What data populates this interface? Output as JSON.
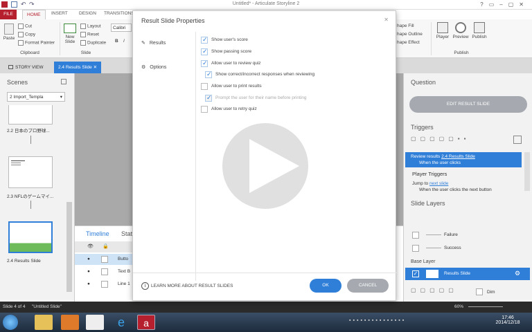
{
  "window": {
    "title": "Untitled* - Articulate Storyline 2"
  },
  "ribbon": {
    "tabs": [
      "FILE",
      "HOME",
      "INSERT",
      "DESIGN",
      "TRANSITIONS"
    ],
    "clipboard": {
      "paste": "Paste",
      "cut": "Cut",
      "copy": "Copy",
      "format_painter": "Format Painter",
      "group": "Clipboard"
    },
    "slide": {
      "new_slide": "New Slide",
      "layout": "Layout",
      "reset": "Reset",
      "duplicate": "Duplicate",
      "group": "Slide"
    },
    "font": {
      "name": "Calibri"
    },
    "shape": {
      "fill": "hape Fill",
      "outline": "hape Outline",
      "effect": "hape Effect"
    },
    "publish": {
      "player": "Player",
      "preview": "Preview",
      "publish": "Publish",
      "group": "Publish"
    }
  },
  "view_tabs": {
    "story": "STORY VIEW",
    "current": "2.4 Results Slide"
  },
  "scenes": {
    "title": "Scenes",
    "dropdown": "2 Import_Templa",
    "items": [
      {
        "label": "2.2 日本のプロ野球..."
      },
      {
        "label": "2.3 NFLのゲームマイ..."
      },
      {
        "label": "2.4 Results Slide"
      }
    ]
  },
  "timeline": {
    "title": "Timeline",
    "states": "Stat",
    "rows": [
      "Butto",
      "Text B",
      "Line 1"
    ]
  },
  "dialog": {
    "title": "Result Slide Properties",
    "nav": [
      {
        "label": "Results"
      },
      {
        "label": "Options"
      }
    ],
    "options": [
      {
        "label": "Show user's score",
        "checked": true,
        "disabled": false
      },
      {
        "label": "Show passing score",
        "checked": true,
        "disabled": false
      },
      {
        "label": "Allow user to review quiz",
        "checked": true,
        "disabled": false
      },
      {
        "label": "Show correct/incorrect responses when reviewing",
        "checked": true,
        "disabled": false
      },
      {
        "label": "Allow user to print results",
        "checked": false,
        "disabled": false
      },
      {
        "label": "Prompt the user for their name before printing",
        "checked": true,
        "disabled": true
      },
      {
        "label": "Allow user to retry quiz",
        "checked": false,
        "disabled": false
      }
    ],
    "learn_more": "LEARN MORE ABOUT RESULT SLIDES",
    "ok": "OK",
    "cancel": "CANCEL"
  },
  "right_panel": {
    "question_title": "Question",
    "edit_button": "EDIT RESULT SLIDE",
    "triggers_title": "Triggers",
    "trigger_selected": {
      "line1a": "Review results ",
      "line1b": "2.4 Results Slide",
      "line2": "When the user clicks"
    },
    "player_triggers": "Player Triggers",
    "player_trigger": {
      "line1a": "Jump to ",
      "line1b": "next slide",
      "line2": "When the user clicks the next button"
    },
    "layers_title": "Slide Layers",
    "layers": [
      "Failure",
      "Success"
    ],
    "base_layer_label": "Base Layer",
    "base_layer": "Results Slide",
    "dim": "Dim"
  },
  "status": {
    "slide": "Slide 4 of 4",
    "name": "\"Untitled Slide\"",
    "zoom": "60%"
  },
  "taskbar": {
    "time": "17:46",
    "date": "2014/12/18"
  },
  "colors": {
    "accent": "#2f7ed8",
    "file_tab": "#b6202e",
    "ok_button": "#2f7ed8",
    "cancel_button": "#a6aab0"
  },
  "overlay": {
    "icon": "play-icon"
  }
}
